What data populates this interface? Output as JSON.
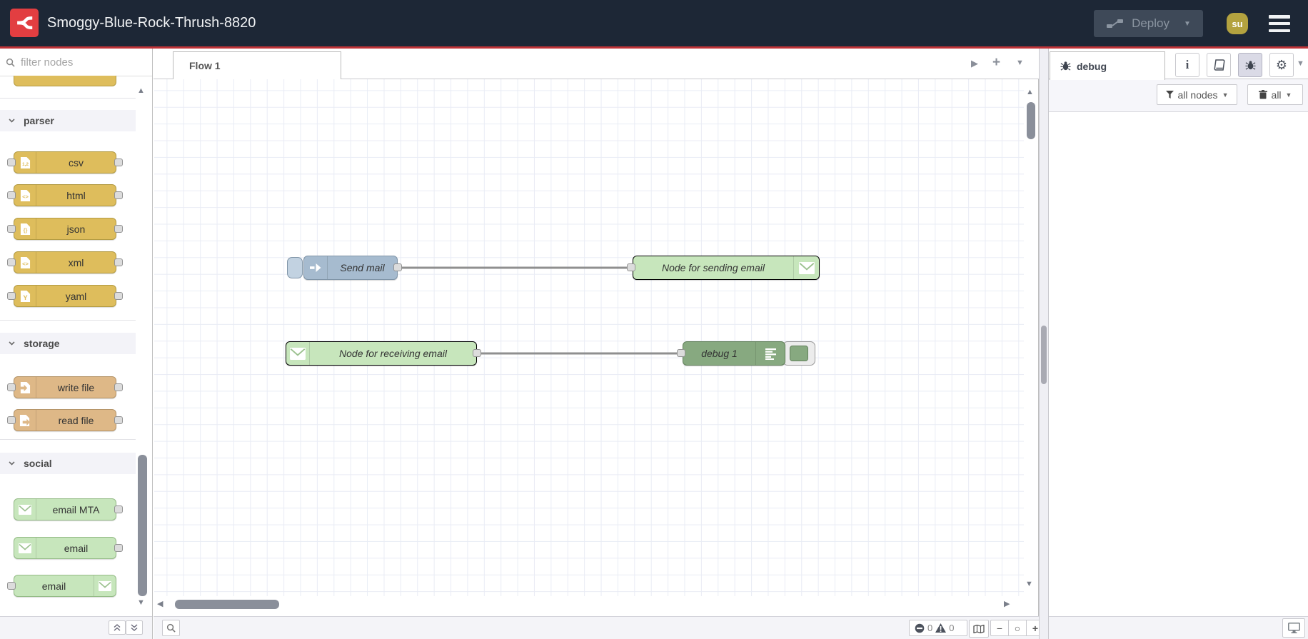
{
  "colors": {
    "header_bg": "#1d2736",
    "accent_red": "#bf3338",
    "logo_red": "#e23e41",
    "avatar_bg": "#b3a23f",
    "deploy_bg": "#3e4958",
    "node_parser": "#debd5c",
    "node_storage": "#deb887",
    "node_email": "#c7e6bc",
    "node_inject": "#a6bbcf",
    "node_debug": "#87a980"
  },
  "header": {
    "title": "Smoggy-Blue-Rock-Thrush-8820",
    "deploy_label": "Deploy",
    "avatar_initials": "su"
  },
  "palette": {
    "search_placeholder": "filter nodes",
    "sections": [
      {
        "label": "parser",
        "nodes": [
          {
            "label": "csv",
            "icon": "file-csv",
            "glyph": "1,2"
          },
          {
            "label": "html",
            "icon": "file-code",
            "glyph": "<>"
          },
          {
            "label": "json",
            "icon": "file-json",
            "glyph": "{}"
          },
          {
            "label": "xml",
            "icon": "file-code",
            "glyph": "<>"
          },
          {
            "label": "yaml",
            "icon": "file-yaml",
            "glyph": "Y"
          }
        ]
      },
      {
        "label": "storage",
        "nodes": [
          {
            "label": "write file",
            "icon": "file-import"
          },
          {
            "label": "read file",
            "icon": "file-export"
          }
        ]
      },
      {
        "label": "social",
        "nodes": [
          {
            "label": "email MTA",
            "icon": "envelope"
          },
          {
            "label": "email",
            "icon": "envelope"
          },
          {
            "label": "email",
            "icon": "envelope"
          }
        ]
      }
    ]
  },
  "workspace": {
    "tab_label": "Flow 1",
    "nodes": [
      {
        "label": "Send mail",
        "type": "inject"
      },
      {
        "label": "Node for sending email",
        "type": "email-out"
      },
      {
        "label": "Node for receiving email",
        "type": "email-in"
      },
      {
        "label": "debug 1",
        "type": "debug"
      }
    ]
  },
  "debug_sidebar": {
    "tab_label": "debug",
    "filter_button": "all nodes",
    "clear_button": "all"
  },
  "footer": {
    "error_count": "0",
    "warning_count": "0"
  },
  "icons": {
    "dropdown": "▼",
    "play": "▶",
    "plus": "+",
    "scroll_up": "▲",
    "scroll_down": "▼",
    "scroll_left": "◀",
    "scroll_right": "▶",
    "zoom_out": "−",
    "zoom_reset": "○",
    "zoom_in": "+",
    "info": "i",
    "gear": "⚙"
  }
}
